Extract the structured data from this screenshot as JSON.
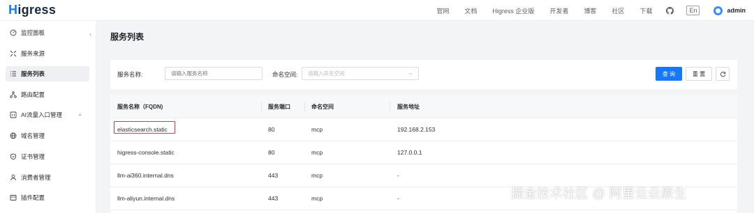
{
  "header": {
    "logo_prefix": "H",
    "logo_rest": "igress",
    "nav": [
      "官网",
      "文档",
      "Higress 企业版",
      "开发者",
      "博客",
      "社区",
      "下载"
    ],
    "lang": "En",
    "user": "admin"
  },
  "sidebar": {
    "items": [
      {
        "label": "监控面板",
        "icon": "dashboard-icon"
      },
      {
        "label": "服务来源",
        "icon": "source-icon"
      },
      {
        "label": "服务列表",
        "icon": "list-icon",
        "active": true
      },
      {
        "label": "路由配置",
        "icon": "route-icon"
      },
      {
        "label": "AI流量入口管理",
        "icon": "ai-icon",
        "expandable": true
      },
      {
        "label": "域名管理",
        "icon": "globe-icon"
      },
      {
        "label": "证书管理",
        "icon": "shield-icon"
      },
      {
        "label": "消费者管理",
        "icon": "user-icon"
      },
      {
        "label": "插件配置",
        "icon": "plugin-icon"
      }
    ]
  },
  "main": {
    "title": "服务列表",
    "filter": {
      "name_label": "服务名称:",
      "name_placeholder": "请输入服务名称",
      "namespace_label": "命名空间:",
      "namespace_placeholder": "请输入命名空间",
      "query_button": "查 询",
      "reset_button": "重 置"
    },
    "table": {
      "columns": [
        "服务名称（FQDN)",
        "服务端口",
        "命名空间",
        "服务地址"
      ],
      "rows": [
        {
          "name": "elasticsearch.static",
          "port": "80",
          "namespace": "mcp",
          "address": "192.168.2.153",
          "highlighted": true
        },
        {
          "name": "higress-console.static",
          "port": "80",
          "namespace": "mcp",
          "address": "127.0.0.1"
        },
        {
          "name": "llm-ai360.internal.dns",
          "port": "443",
          "namespace": "mcp",
          "address": "-"
        },
        {
          "name": "llm-aliyun.internal.dns",
          "port": "443",
          "namespace": "mcp",
          "address": "-"
        }
      ]
    }
  },
  "watermark": "掘金技术社区 @ 阿里云云原生",
  "colors": {
    "primary": "#1677ff",
    "highlight": "#d9363e",
    "logo": "#1b2a3a"
  }
}
